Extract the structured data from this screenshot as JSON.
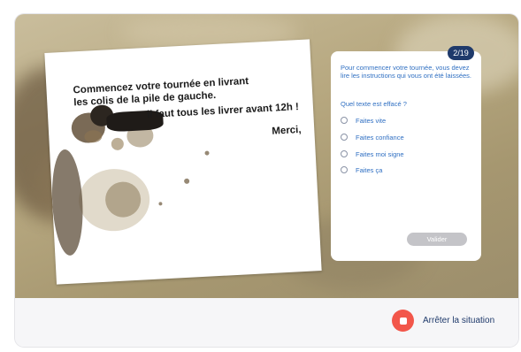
{
  "colors": {
    "badge": "#1f3a6b",
    "text_blue": "#2f6fc2",
    "stop_red": "#f2564a",
    "button_disabled": "#c4c4c8",
    "scene_tan": "#b7a880"
  },
  "note": {
    "lines": [
      "Commencez votre tournée en livrant",
      "les colis de la pile de gauche.",
      "il faut tous les livrer avant 12h !",
      "Merci,"
    ]
  },
  "panel": {
    "page_indicator": "2/19",
    "instructions": "Pour commencer votre tournée, vous devez lire les instructions qui vous ont été laissées.",
    "question": "Quel texte est effacé ?",
    "options": [
      "Faites vite",
      "Faites confiance",
      "Faites moi signe",
      "Faites ça"
    ],
    "validate_label": "Valider",
    "validate_enabled": false
  },
  "footer": {
    "stop_label": "Arrêter la situation",
    "stop_icon": "stop-icon"
  }
}
